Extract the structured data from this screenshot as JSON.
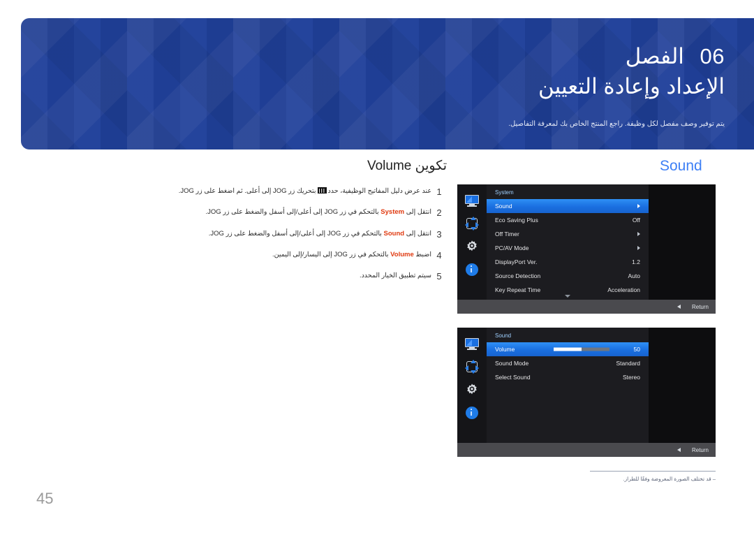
{
  "banner": {
    "chapter_label": "الفصل",
    "chapter_number": "06",
    "title": "الإعداد وإعادة التعيين",
    "subtitle": "يتم توفير وصف مفصل لكل وظيفة. راجع المنتج الخاص بك لمعرفة التفاصيل."
  },
  "instructions": {
    "title": "تكوين Volume",
    "steps": [
      {
        "num": "1",
        "text_before": "عند عرض دليل المفاتيح الوظيفية، حدد",
        "icon": "menu-segments-icon",
        "text_after": "بتحريك زر JOG إلى أعلى. ثم اضغط على زر JOG."
      },
      {
        "num": "2",
        "text_before": "انتقل إلى",
        "keyword": "System",
        "text_after": "بالتحكم في زر JOG إلى أعلى/إلى أسفل والضغط على زر JOG."
      },
      {
        "num": "3",
        "text_before": "انتقل إلى",
        "keyword": "Sound",
        "text_after": "بالتحكم في زر JOG إلى أعلى/إلى أسفل والضغط على زر JOG."
      },
      {
        "num": "4",
        "text_before": "اضبط",
        "keyword": "Volume",
        "text_after": "بالتحكم في زر JOG إلى اليسار/إلى اليمين."
      },
      {
        "num": "5",
        "text_before": "سيتم تطبيق الخيار المحدد.",
        "keyword": "",
        "text_after": ""
      }
    ]
  },
  "osd_heading": "Sound",
  "osd_panels": [
    {
      "title": "System",
      "sidebar_icons": [
        "monitor-icon",
        "move-icon",
        "gear-icon",
        "info-icon"
      ],
      "rows": [
        {
          "label": "Sound",
          "value": "",
          "arrow": true,
          "selected": true
        },
        {
          "label": "Eco Saving Plus",
          "value": "Off",
          "arrow": false,
          "selected": false
        },
        {
          "label": "Off Timer",
          "value": "",
          "arrow": true,
          "selected": false
        },
        {
          "label": "PC/AV Mode",
          "value": "",
          "arrow": true,
          "selected": false
        },
        {
          "label": "DisplayPort Ver.",
          "value": "1.2",
          "arrow": false,
          "selected": false
        },
        {
          "label": "Source Detection",
          "value": "Auto",
          "arrow": false,
          "selected": false
        },
        {
          "label": "Key Repeat Time",
          "value": "Acceleration",
          "arrow": false,
          "selected": false
        }
      ],
      "has_more": true,
      "return_label": "Return"
    },
    {
      "title": "Sound",
      "sidebar_icons": [
        "monitor-icon",
        "move-icon",
        "gear-icon",
        "info-icon"
      ],
      "rows": [
        {
          "label": "Volume",
          "value": "50",
          "slider": 50,
          "selected": true
        },
        {
          "label": "Sound Mode",
          "value": "Standard",
          "selected": false
        },
        {
          "label": "Select Sound",
          "value": "Stereo",
          "selected": false
        }
      ],
      "has_more": false,
      "return_label": "Return"
    }
  ],
  "note": "‒ قد تختلف الصورة المعروضة وفقًا للطراز.",
  "page_number": "45",
  "colors": {
    "banner_blue": "#20409a",
    "accent_blue": "#3d7ff5",
    "keyword_red": "#e03a10",
    "osd_highlight": "#1a6fe0",
    "osd_bg": "#1c1c20"
  }
}
